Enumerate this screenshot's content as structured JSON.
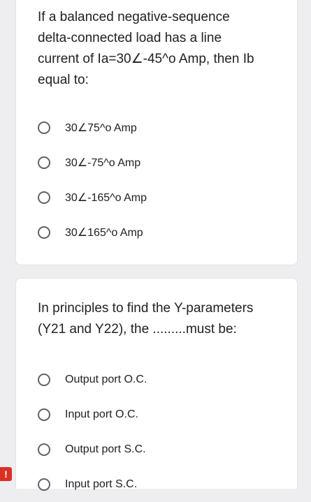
{
  "questions": [
    {
      "text": "If a balanced negative-sequence\ndelta-connected load has a line\ncurrent of Ia=30∠-45^o Amp, then Ib\nequal to:",
      "options": [
        "30∠75^o Amp",
        "30∠-75^o Amp",
        "30∠-165^o Amp",
        "30∠165^o Amp"
      ]
    },
    {
      "text": "In principles to find the Y-parameters\n(Y21 and Y22), the .........must be:",
      "options": [
        "Output port O.C.",
        "Input port O.C.",
        "Output port S.C.",
        "Input port S.C."
      ]
    }
  ],
  "alert_icon": {
    "icon": "exclamation-icon",
    "glyph": "!",
    "color": "#d93025"
  },
  "colors": {
    "background": "#eeeef1",
    "card": "#ffffff",
    "text": "#202124",
    "radio_border": "#5f6368"
  }
}
